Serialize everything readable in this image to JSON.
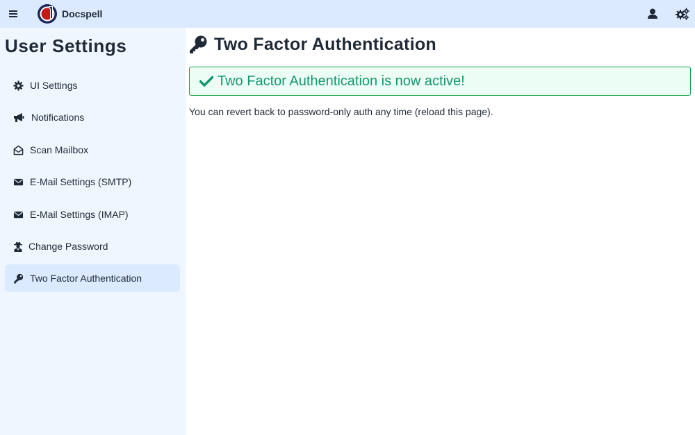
{
  "header": {
    "app_name": "Docspell",
    "icons": {
      "menu": "hamburger-menu-icon",
      "user": "user-icon",
      "admin": "cogs-icon"
    }
  },
  "sidebar": {
    "title": "User Settings",
    "items": [
      {
        "label": "UI Settings",
        "icon": "cog-icon",
        "active": false
      },
      {
        "label": "Notifications",
        "icon": "bullhorn-icon",
        "active": false
      },
      {
        "label": "Scan Mailbox",
        "icon": "envelope-open-icon",
        "active": false
      },
      {
        "label": "E-Mail Settings (SMTP)",
        "icon": "envelope-icon",
        "active": false
      },
      {
        "label": "E-Mail Settings (IMAP)",
        "icon": "envelope-icon",
        "active": false
      },
      {
        "label": "Change Password",
        "icon": "user-secret-icon",
        "active": false
      },
      {
        "label": "Two Factor Authentication",
        "icon": "key-icon",
        "active": true
      }
    ]
  },
  "main": {
    "title": "Two Factor Authentication",
    "title_icon": "key-icon",
    "alert": {
      "text": "Two Factor Authentication is now active!",
      "icon": "check-icon"
    },
    "info": "You can revert back to password-only auth any time (reload this page)."
  },
  "colors": {
    "header_bg": "#dbeafe",
    "sidebar_bg": "#eff6ff",
    "active_item_bg": "#dbeafe",
    "success_text": "#15966f",
    "success_border": "#16a34a",
    "success_bg": "#ecfdf5",
    "logo_navy": "#1e2a5a",
    "logo_red": "#c41a1a"
  }
}
